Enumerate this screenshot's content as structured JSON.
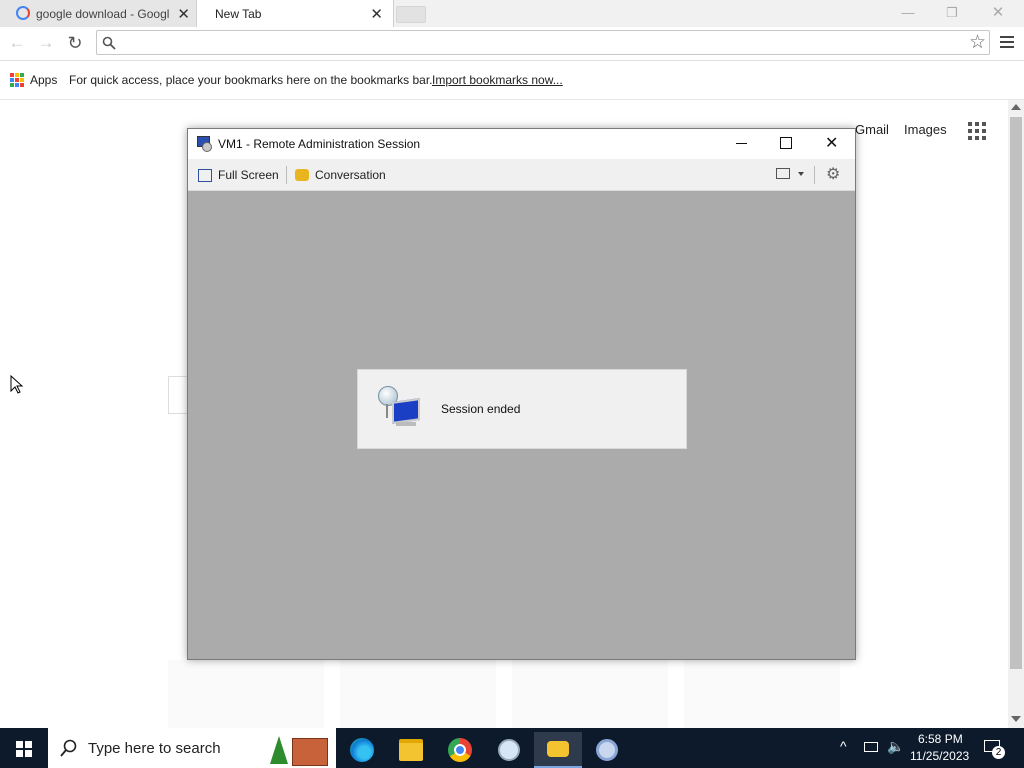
{
  "browser": {
    "tabs": [
      {
        "label": "google download - Googl",
        "active": false
      },
      {
        "label": "New Tab",
        "active": true
      }
    ],
    "address": {
      "value": "",
      "placeholder": ""
    },
    "bookmarks_bar": {
      "apps_label": "Apps",
      "hint_text": "For quick access, place your bookmarks here on the bookmarks bar.",
      "import_link": "Import bookmarks now..."
    },
    "page": {
      "gmail_link": "Gmail",
      "images_link": "Images"
    }
  },
  "remote_window": {
    "title": "VM1 - Remote Administration Session",
    "toolbar": {
      "full_screen_label": "Full Screen",
      "conversation_label": "Conversation"
    },
    "dialog": {
      "message": "Session ended"
    },
    "content_color": "#ababab"
  },
  "taskbar": {
    "search_placeholder": "Type here to search",
    "clock": {
      "time": "6:58 PM",
      "date": "11/25/2023"
    },
    "notification_count": "2",
    "pinned": [
      "edge-icon",
      "file-explorer-icon",
      "chrome-icon",
      "paint-icon",
      "messaging-icon",
      "chrome-alt-icon"
    ]
  },
  "colors": {
    "taskbar": "#0d1a2b",
    "accent_blue": "#1a73e8"
  }
}
